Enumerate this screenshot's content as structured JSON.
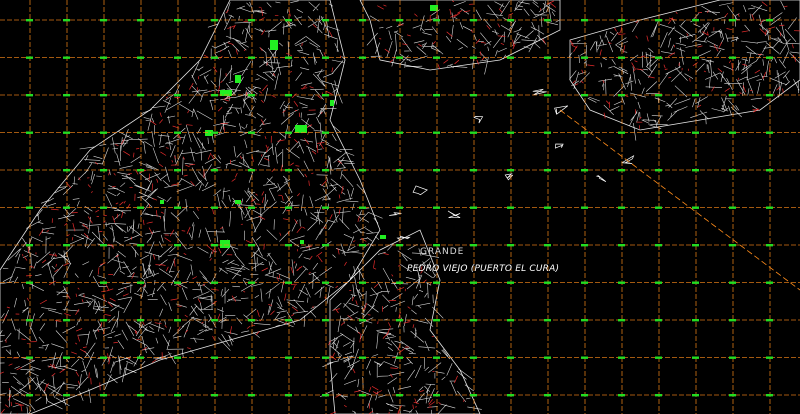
{
  "map": {
    "background_color": "#000000",
    "grid_color": "#ff8c1a",
    "grid_marker_color": "#22dd22",
    "parcel_color": "#ffffff",
    "detail_color": "#ff3030",
    "vegetation_color": "#22ee22",
    "labels": {
      "place_partial": "GRANDE",
      "place_main": "PEDRO VIEJO (PUERTO EL CURA)"
    }
  }
}
